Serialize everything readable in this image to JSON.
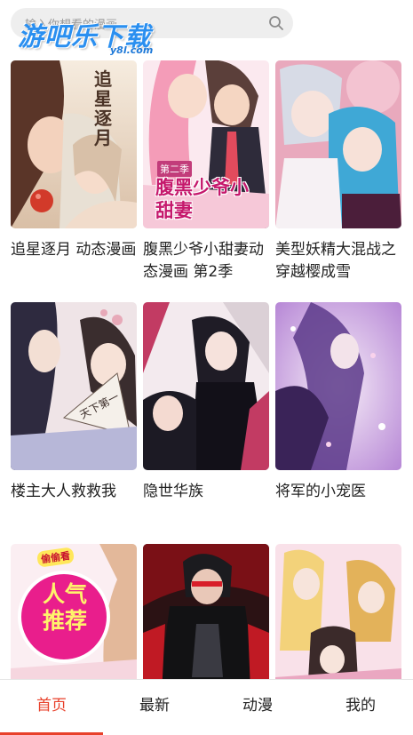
{
  "header": {
    "search_placeholder": "输入你想看的漫画",
    "logo_text": "游吧乐下载",
    "logo_sub": "y8l.com"
  },
  "comics": [
    {
      "title": "追星逐月 动态漫画",
      "cover_text": "追星逐月",
      "colors": [
        "#f4e6d6",
        "#c9a27b",
        "#7e4a32"
      ]
    },
    {
      "title": "腹黑少爷小甜妻动态漫画 第2季",
      "cover_text": "腹黑少爷小甜妻",
      "cover_sub": "第二季",
      "colors": [
        "#f7d1e0",
        "#d55a8f",
        "#6b2a55"
      ]
    },
    {
      "title": "美型妖精大混战之穿越樱成雪",
      "cover_text": "",
      "colors": [
        "#f2c2cf",
        "#4ab0d8",
        "#2a3f78"
      ]
    },
    {
      "title": "楼主大人救救我",
      "cover_text": "天下第一",
      "colors": [
        "#eedfe3",
        "#e0a3b4",
        "#2d2840"
      ]
    },
    {
      "title": "隐世华族",
      "cover_text": "",
      "colors": [
        "#f0e4ea",
        "#c2365e",
        "#1e1a2a"
      ]
    },
    {
      "title": "将军的小宠医",
      "cover_text": "",
      "colors": [
        "#e8d9f0",
        "#9a5cc6",
        "#3b2660"
      ]
    },
    {
      "title": "",
      "cover_text": "人气推荐",
      "badge": "偷偷看",
      "colors": [
        "#fbe7ee",
        "#e91e8c",
        "#fff36b"
      ]
    },
    {
      "title": "",
      "cover_text": "",
      "colors": [
        "#2a1012",
        "#d8202a",
        "#101010"
      ]
    },
    {
      "title": "",
      "cover_text": "",
      "colors": [
        "#f7dbe5",
        "#e58fae",
        "#f5d77d"
      ]
    }
  ],
  "tabbar": {
    "items": [
      "首页",
      "最新",
      "动漫",
      "我的"
    ],
    "active": 0
  },
  "colors": {
    "accent": "#e8412b",
    "text": "#222222",
    "search_bg": "#eeeeee"
  }
}
